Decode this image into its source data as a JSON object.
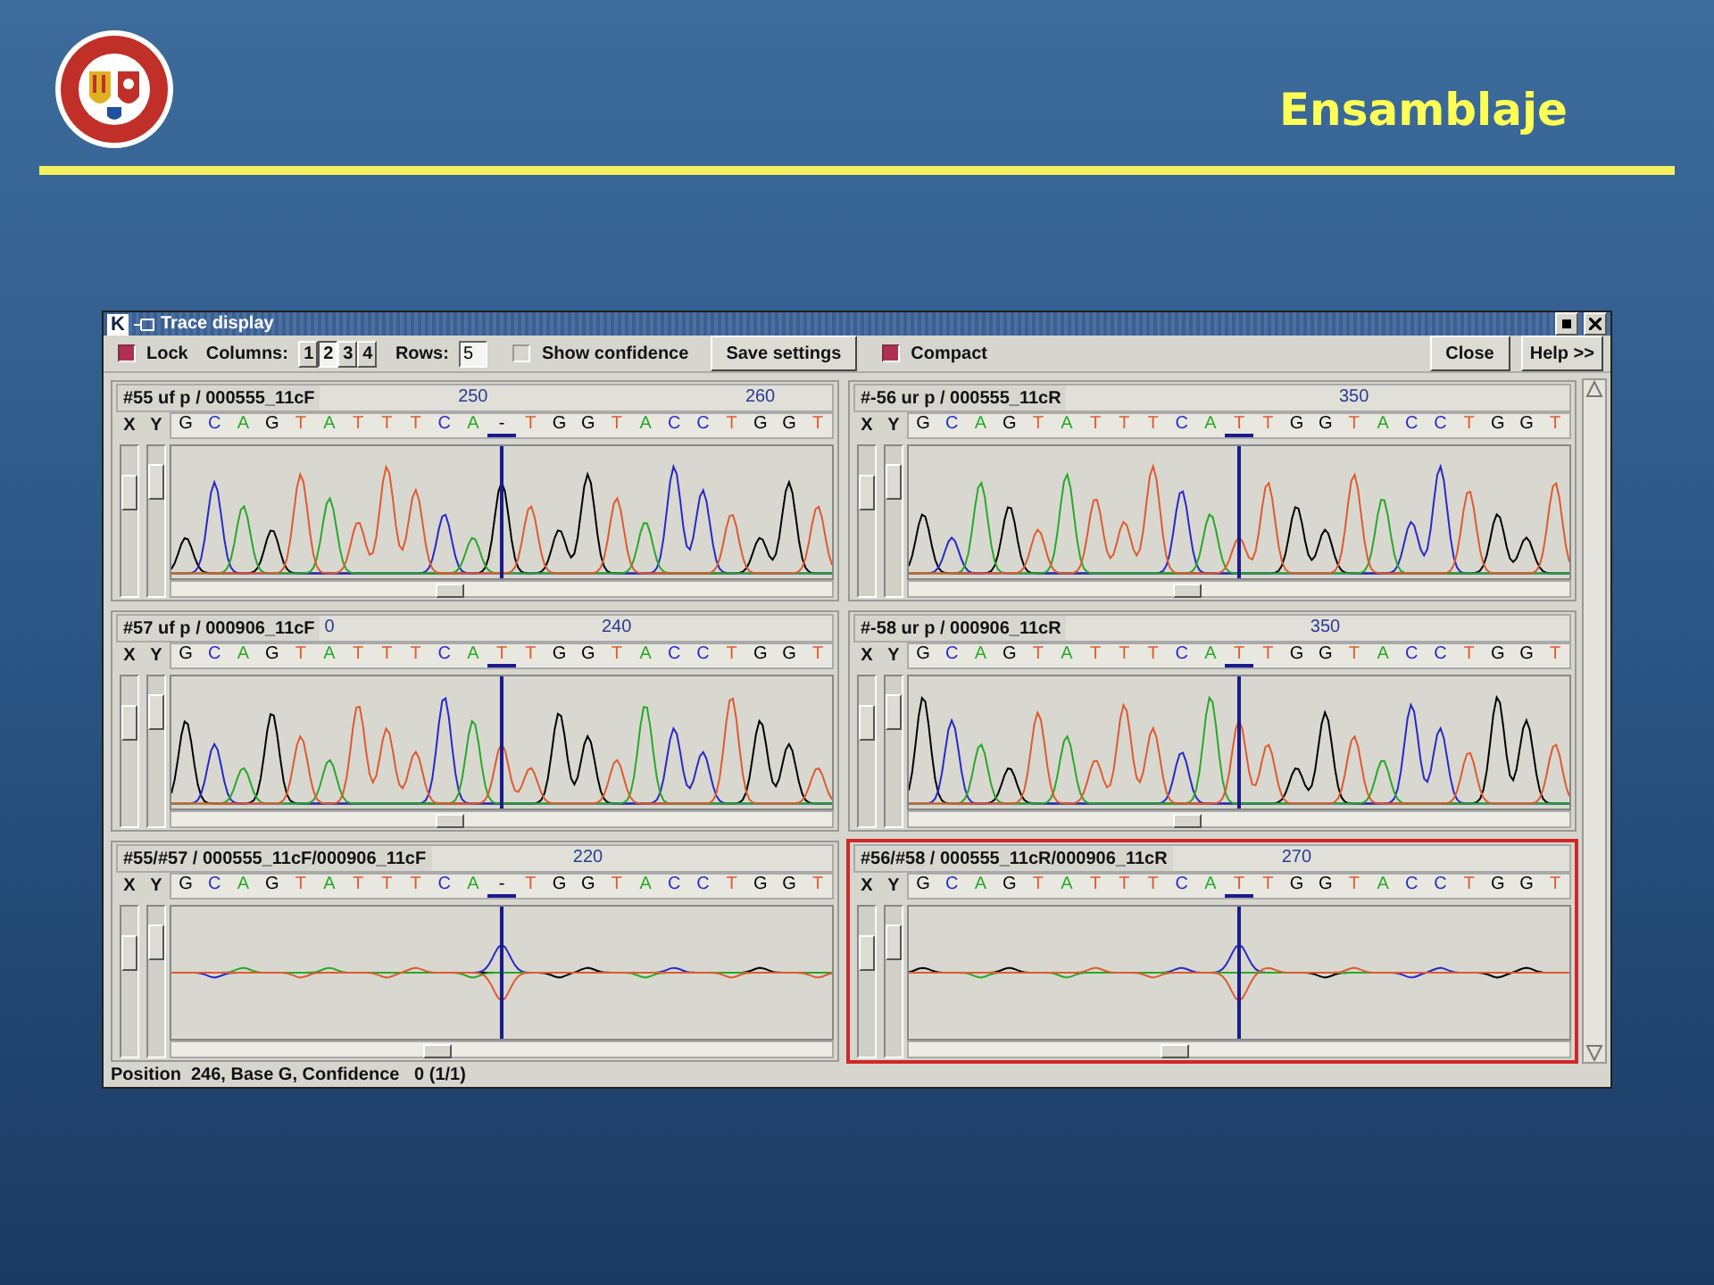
{
  "slide": {
    "title": "Ensamblaje"
  },
  "window": {
    "icon_letter": "K",
    "title": "Trace display"
  },
  "toolbar": {
    "lock": {
      "label": "Lock",
      "checked": true
    },
    "columns": {
      "label": "Columns:",
      "options": [
        {
          "label": "1",
          "selected": false
        },
        {
          "label": "2",
          "selected": true
        },
        {
          "label": "3",
          "selected": false
        },
        {
          "label": "4",
          "selected": false
        }
      ]
    },
    "rows": {
      "label": "Rows:",
      "value": "5"
    },
    "show_confidence": {
      "label": "Show confidence",
      "checked": false
    },
    "save_button": "Save settings",
    "compact": {
      "label": "Compact",
      "checked": true
    },
    "close_button": "Close",
    "help_button": "Help >>"
  },
  "panels": [
    {
      "name": "#55 uf p / 000555_11cF",
      "kind": "trace",
      "selected": false,
      "sliders": [
        {
          "label": "X",
          "level": 0.75
        },
        {
          "label": "Y",
          "level": 0.85
        }
      ],
      "bases": [
        {
          "base": "G",
          "color": "#000000",
          "selected": false
        },
        {
          "base": "C",
          "color": "#2828c8",
          "selected": false
        },
        {
          "base": "A",
          "color": "#28a828",
          "selected": false
        },
        {
          "base": "G",
          "color": "#000000",
          "selected": false
        },
        {
          "base": "T",
          "color": "#e05a30",
          "selected": false
        },
        {
          "base": "A",
          "color": "#28a828",
          "selected": false
        },
        {
          "base": "T",
          "color": "#e05a30",
          "selected": false
        },
        {
          "base": "T",
          "color": "#e05a30",
          "selected": false
        },
        {
          "base": "T",
          "color": "#e05a30",
          "selected": false
        },
        {
          "base": "C",
          "color": "#2828c8",
          "selected": false
        },
        {
          "base": "A",
          "color": "#28a828",
          "selected": false,
          "tick": "250"
        },
        {
          "base": "-",
          "color": "#000000",
          "selected": true
        },
        {
          "base": "T",
          "color": "#e05a30",
          "selected": false
        },
        {
          "base": "G",
          "color": "#000000",
          "selected": false
        },
        {
          "base": "G",
          "color": "#000000",
          "selected": false
        },
        {
          "base": "T",
          "color": "#e05a30",
          "selected": false
        },
        {
          "base": "A",
          "color": "#28a828",
          "selected": false
        },
        {
          "base": "C",
          "color": "#2828c8",
          "selected": false
        },
        {
          "base": "C",
          "color": "#2828c8",
          "selected": false
        },
        {
          "base": "T",
          "color": "#e05a30",
          "selected": false
        },
        {
          "base": "G",
          "color": "#000000",
          "selected": false,
          "tick": "260"
        },
        {
          "base": "G",
          "color": "#000000",
          "selected": false
        },
        {
          "base": "T",
          "color": "#e05a30",
          "selected": false
        }
      ]
    },
    {
      "name": "#-56 ur p / 000555_11cR",
      "kind": "trace",
      "selected": false,
      "sliders": [
        {
          "label": "X",
          "level": 0.75
        },
        {
          "label": "Y",
          "level": 0.85
        }
      ],
      "bases": [
        {
          "base": "G",
          "color": "#000000",
          "selected": false
        },
        {
          "base": "C",
          "color": "#2828c8",
          "selected": false
        },
        {
          "base": "A",
          "color": "#28a828",
          "selected": false
        },
        {
          "base": "G",
          "color": "#000000",
          "selected": false
        },
        {
          "base": "T",
          "color": "#e05a30",
          "selected": false
        },
        {
          "base": "A",
          "color": "#28a828",
          "selected": false
        },
        {
          "base": "T",
          "color": "#e05a30",
          "selected": false
        },
        {
          "base": "T",
          "color": "#e05a30",
          "selected": false
        },
        {
          "base": "T",
          "color": "#e05a30",
          "selected": false
        },
        {
          "base": "C",
          "color": "#2828c8",
          "selected": false
        },
        {
          "base": "A",
          "color": "#28a828",
          "selected": false
        },
        {
          "base": "T",
          "color": "#e05a30",
          "selected": true
        },
        {
          "base": "T",
          "color": "#e05a30",
          "selected": false
        },
        {
          "base": "G",
          "color": "#000000",
          "selected": false
        },
        {
          "base": "G",
          "color": "#000000",
          "selected": false
        },
        {
          "base": "T",
          "color": "#e05a30",
          "selected": false,
          "tick": "350"
        },
        {
          "base": "A",
          "color": "#28a828",
          "selected": false
        },
        {
          "base": "C",
          "color": "#2828c8",
          "selected": false
        },
        {
          "base": "C",
          "color": "#2828c8",
          "selected": false
        },
        {
          "base": "T",
          "color": "#e05a30",
          "selected": false
        },
        {
          "base": "G",
          "color": "#000000",
          "selected": false
        },
        {
          "base": "G",
          "color": "#000000",
          "selected": false
        },
        {
          "base": "T",
          "color": "#e05a30",
          "selected": false
        }
      ]
    },
    {
      "name": "#57 uf p / 000906_11cF",
      "kind": "trace",
      "selected": false,
      "sliders": [
        {
          "label": "X",
          "level": 0.75
        },
        {
          "label": "Y",
          "level": 0.85
        }
      ],
      "bases": [
        {
          "base": "G",
          "color": "#000000",
          "selected": false
        },
        {
          "base": "C",
          "color": "#2828c8",
          "selected": false
        },
        {
          "base": "A",
          "color": "#28a828",
          "selected": false
        },
        {
          "base": "G",
          "color": "#000000",
          "selected": false
        },
        {
          "base": "T",
          "color": "#e05a30",
          "selected": false
        },
        {
          "base": "A",
          "color": "#28a828",
          "selected": false,
          "tick": "0"
        },
        {
          "base": "T",
          "color": "#e05a30",
          "selected": false
        },
        {
          "base": "T",
          "color": "#e05a30",
          "selected": false
        },
        {
          "base": "T",
          "color": "#e05a30",
          "selected": false
        },
        {
          "base": "C",
          "color": "#2828c8",
          "selected": false
        },
        {
          "base": "A",
          "color": "#28a828",
          "selected": false
        },
        {
          "base": "T",
          "color": "#e05a30",
          "selected": true
        },
        {
          "base": "T",
          "color": "#e05a30",
          "selected": false
        },
        {
          "base": "G",
          "color": "#000000",
          "selected": false
        },
        {
          "base": "G",
          "color": "#000000",
          "selected": false
        },
        {
          "base": "T",
          "color": "#e05a30",
          "selected": false,
          "tick": "240"
        },
        {
          "base": "A",
          "color": "#28a828",
          "selected": false
        },
        {
          "base": "C",
          "color": "#2828c8",
          "selected": false
        },
        {
          "base": "C",
          "color": "#2828c8",
          "selected": false
        },
        {
          "base": "T",
          "color": "#e05a30",
          "selected": false
        },
        {
          "base": "G",
          "color": "#000000",
          "selected": false
        },
        {
          "base": "G",
          "color": "#000000",
          "selected": false
        },
        {
          "base": "T",
          "color": "#e05a30",
          "selected": false
        }
      ]
    },
    {
      "name": "#-58 ur p / 000906_11cR",
      "kind": "trace",
      "selected": false,
      "sliders": [
        {
          "label": "X",
          "level": 0.75
        },
        {
          "label": "Y",
          "level": 0.85
        }
      ],
      "bases": [
        {
          "base": "G",
          "color": "#000000",
          "selected": false
        },
        {
          "base": "C",
          "color": "#2828c8",
          "selected": false
        },
        {
          "base": "A",
          "color": "#28a828",
          "selected": false
        },
        {
          "base": "G",
          "color": "#000000",
          "selected": false
        },
        {
          "base": "T",
          "color": "#e05a30",
          "selected": false
        },
        {
          "base": "A",
          "color": "#28a828",
          "selected": false
        },
        {
          "base": "T",
          "color": "#e05a30",
          "selected": false
        },
        {
          "base": "T",
          "color": "#e05a30",
          "selected": false
        },
        {
          "base": "T",
          "color": "#e05a30",
          "selected": false
        },
        {
          "base": "C",
          "color": "#2828c8",
          "selected": false
        },
        {
          "base": "A",
          "color": "#28a828",
          "selected": false
        },
        {
          "base": "T",
          "color": "#e05a30",
          "selected": true
        },
        {
          "base": "T",
          "color": "#e05a30",
          "selected": false
        },
        {
          "base": "G",
          "color": "#000000",
          "selected": false
        },
        {
          "base": "G",
          "color": "#000000",
          "selected": false,
          "tick": "350"
        },
        {
          "base": "T",
          "color": "#e05a30",
          "selected": false
        },
        {
          "base": "A",
          "color": "#28a828",
          "selected": false
        },
        {
          "base": "C",
          "color": "#2828c8",
          "selected": false
        },
        {
          "base": "C",
          "color": "#2828c8",
          "selected": false
        },
        {
          "base": "T",
          "color": "#e05a30",
          "selected": false
        },
        {
          "base": "G",
          "color": "#000000",
          "selected": false
        },
        {
          "base": "G",
          "color": "#000000",
          "selected": false
        },
        {
          "base": "T",
          "color": "#e05a30",
          "selected": false
        }
      ]
    },
    {
      "name": "#55/#57 / 000555_11cF/000906_11cF",
      "kind": "difference",
      "selected": false,
      "sliders": [
        {
          "label": "X",
          "level": 0.75
        },
        {
          "label": "Y",
          "level": 0.85
        }
      ],
      "bases": [
        {
          "base": "G",
          "color": "#000000",
          "selected": false
        },
        {
          "base": "C",
          "color": "#2828c8",
          "selected": false
        },
        {
          "base": "A",
          "color": "#28a828",
          "selected": false
        },
        {
          "base": "G",
          "color": "#000000",
          "selected": false
        },
        {
          "base": "T",
          "color": "#e05a30",
          "selected": false
        },
        {
          "base": "A",
          "color": "#28a828",
          "selected": false
        },
        {
          "base": "T",
          "color": "#e05a30",
          "selected": false
        },
        {
          "base": "T",
          "color": "#e05a30",
          "selected": false
        },
        {
          "base": "T",
          "color": "#e05a30",
          "selected": false
        },
        {
          "base": "C",
          "color": "#2828c8",
          "selected": false
        },
        {
          "base": "A",
          "color": "#28a828",
          "selected": false
        },
        {
          "base": "-",
          "color": "#000000",
          "selected": true
        },
        {
          "base": "T",
          "color": "#e05a30",
          "selected": false
        },
        {
          "base": "G",
          "color": "#000000",
          "selected": false
        },
        {
          "base": "G",
          "color": "#000000",
          "selected": false,
          "tick": "220"
        },
        {
          "base": "T",
          "color": "#e05a30",
          "selected": false
        },
        {
          "base": "A",
          "color": "#28a828",
          "selected": false
        },
        {
          "base": "C",
          "color": "#2828c8",
          "selected": false
        },
        {
          "base": "C",
          "color": "#2828c8",
          "selected": false
        },
        {
          "base": "T",
          "color": "#e05a30",
          "selected": false
        },
        {
          "base": "G",
          "color": "#000000",
          "selected": false
        },
        {
          "base": "G",
          "color": "#000000",
          "selected": false
        },
        {
          "base": "T",
          "color": "#e05a30",
          "selected": false
        }
      ]
    },
    {
      "name": "#56/#58 / 000555_11cR/000906_11cR",
      "kind": "difference",
      "selected": true,
      "sliders": [
        {
          "label": "X",
          "level": 0.75
        },
        {
          "label": "Y",
          "level": 0.85
        }
      ],
      "bases": [
        {
          "base": "G",
          "color": "#000000",
          "selected": false
        },
        {
          "base": "C",
          "color": "#2828c8",
          "selected": false
        },
        {
          "base": "A",
          "color": "#28a828",
          "selected": false
        },
        {
          "base": "G",
          "color": "#000000",
          "selected": false
        },
        {
          "base": "T",
          "color": "#e05a30",
          "selected": false
        },
        {
          "base": "A",
          "color": "#28a828",
          "selected": false
        },
        {
          "base": "T",
          "color": "#e05a30",
          "selected": false
        },
        {
          "base": "T",
          "color": "#e05a30",
          "selected": false
        },
        {
          "base": "T",
          "color": "#e05a30",
          "selected": false
        },
        {
          "base": "C",
          "color": "#2828c8",
          "selected": false
        },
        {
          "base": "A",
          "color": "#28a828",
          "selected": false
        },
        {
          "base": "T",
          "color": "#e05a30",
          "selected": true
        },
        {
          "base": "T",
          "color": "#e05a30",
          "selected": false
        },
        {
          "base": "G",
          "color": "#000000",
          "selected": false,
          "tick": "270"
        },
        {
          "base": "G",
          "color": "#000000",
          "selected": false
        },
        {
          "base": "T",
          "color": "#e05a30",
          "selected": false
        },
        {
          "base": "A",
          "color": "#28a828",
          "selected": false
        },
        {
          "base": "C",
          "color": "#2828c8",
          "selected": false
        },
        {
          "base": "C",
          "color": "#2828c8",
          "selected": false
        },
        {
          "base": "T",
          "color": "#e05a30",
          "selected": false
        },
        {
          "base": "G",
          "color": "#000000",
          "selected": false
        },
        {
          "base": "G",
          "color": "#000000",
          "selected": false
        },
        {
          "base": "T",
          "color": "#e05a30",
          "selected": false
        }
      ]
    }
  ],
  "status_bar": "Position  246, Base G, Confidence   0 (1/1)"
}
